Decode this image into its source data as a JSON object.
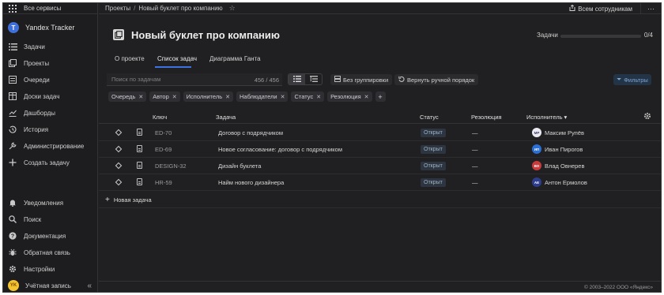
{
  "sidebar": {
    "top_label": "Все сервисы",
    "brand": {
      "logo": "T",
      "name": "Yandex Tracker"
    },
    "nav": [
      {
        "label": "Задачи",
        "icon": "list-icon"
      },
      {
        "label": "Проекты",
        "icon": "projects-icon"
      },
      {
        "label": "Очереди",
        "icon": "queue-icon"
      },
      {
        "label": "Доски задач",
        "icon": "board-icon"
      },
      {
        "label": "Дашборды",
        "icon": "chart-icon"
      },
      {
        "label": "История",
        "icon": "history-icon"
      },
      {
        "label": "Администрирование",
        "icon": "wrench-icon"
      },
      {
        "label": "Создать задачу",
        "icon": "plus-icon"
      }
    ],
    "bottom": [
      {
        "label": "Уведомления",
        "icon": "bell-icon"
      },
      {
        "label": "Поиск",
        "icon": "search-icon"
      },
      {
        "label": "Документация",
        "icon": "help-icon"
      },
      {
        "label": "Обратная связь",
        "icon": "bug-icon"
      },
      {
        "label": "Настройки",
        "icon": "gear-icon"
      }
    ],
    "account": {
      "label": "Учётная запись",
      "avatar": "YK"
    },
    "collapse_glyph": "«"
  },
  "topbar": {
    "breadcrumb": [
      "Проекты",
      "Новый буклет про компанию"
    ],
    "breadcrumb_sep": "/",
    "all_staff": "Всем сотрудникам",
    "more": "···"
  },
  "header": {
    "title": "Новый буклет про компанию",
    "progress_label": "Задачи",
    "progress_count": "0/4",
    "progress_fraction": 0
  },
  "tabs": [
    {
      "label": "О проекте",
      "active": false
    },
    {
      "label": "Список задач",
      "active": true
    },
    {
      "label": "Диаграмма Ганта",
      "active": false
    }
  ],
  "toolbar": {
    "search_placeholder": "Поиск по задачам",
    "search_count": "456 / 456",
    "group_label": "Без группировки",
    "reset_order_label": "Вернуть ручной порядок",
    "filters_label": "Фильтры"
  },
  "chips": [
    "Очередь",
    "Автор",
    "Исполнитель",
    "Наблюдатели",
    "Статус",
    "Резолюция"
  ],
  "table": {
    "columns": {
      "key": "Ключ",
      "task": "Задача",
      "status": "Статус",
      "resolution": "Резолюция",
      "assignee": "Исполнитель ▾"
    },
    "rows": [
      {
        "key": "ED-70",
        "task": "Договор с подрядчиком",
        "status": "Открыт",
        "resolution": "—",
        "assignee": "Максим Рупёв",
        "avatar": "МР",
        "avatar_color": "#e9e9ef",
        "avatar_text": "#3b3b6b"
      },
      {
        "key": "ED-69",
        "task": "Новое согласование: договор с подрядчиком",
        "status": "Открыт",
        "resolution": "—",
        "assignee": "Иван Пирогов",
        "avatar": "ИП",
        "avatar_color": "#2a6fd6",
        "avatar_text": "#ffffff"
      },
      {
        "key": "DESIGN-32",
        "task": "Дизайн буклета",
        "status": "Открыт",
        "resolution": "—",
        "assignee": "Влад Овнерев",
        "avatar": "ВО",
        "avatar_color": "#c93a3a",
        "avatar_text": "#ffffff"
      },
      {
        "key": "HR-59",
        "task": "Найм нового дизайнера",
        "status": "Открыт",
        "resolution": "—",
        "assignee": "Антон Ермолов",
        "avatar": "АЕ",
        "avatar_color": "#2d3c8c",
        "avatar_text": "#ffffff"
      }
    ],
    "new_task_label": "Новая задача"
  },
  "footer": "© 2003–2022 ООО «Яндекс»"
}
